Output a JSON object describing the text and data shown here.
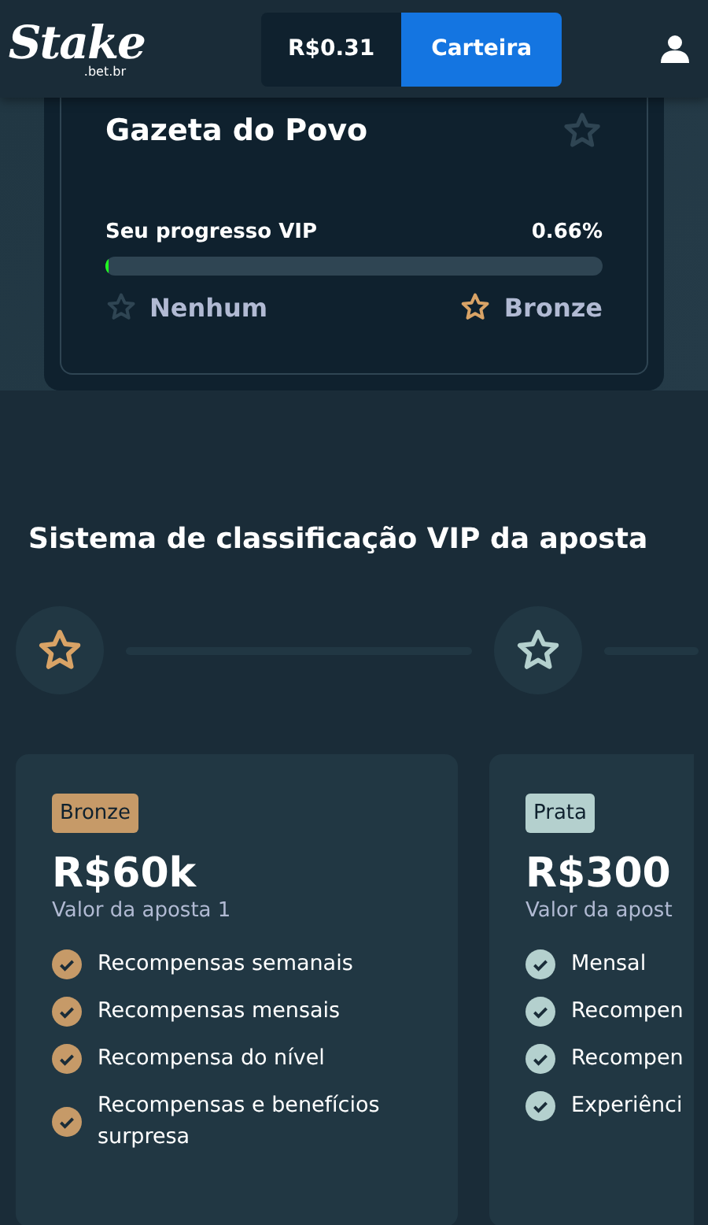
{
  "header": {
    "logo": "Stake",
    "logo_suffix": ".bet.br",
    "balance": "R$0.31",
    "wallet_button": "Carteira"
  },
  "profile_card": {
    "name": "Gazeta do Povo",
    "progress_label": "Seu progresso VIP",
    "progress_value": "0.66%",
    "level": 0.0066,
    "current_rank": "Nenhum",
    "next_rank": "Bronze"
  },
  "section_title": "Sistema de classificação VIP da aposta",
  "timeline": [
    {
      "color": "#d9a366"
    },
    {
      "color": "#b4d0ce"
    }
  ],
  "tiers": [
    {
      "badge": "Bronze",
      "color": "#c69a68",
      "amount": "R$60k",
      "subtitle": "Valor da aposta 1",
      "benefits": [
        "Recompensas semanais",
        "Recompensas mensais",
        "Recompensa do nível",
        "Recompensas e benefícios surpresa"
      ]
    },
    {
      "badge": "Prata",
      "color": "#b4d0ce",
      "amount": "R$300",
      "subtitle": "Valor da apost",
      "benefits": [
        "Mensal",
        "Recompen",
        "Recompen",
        "Experiênci"
      ]
    }
  ]
}
